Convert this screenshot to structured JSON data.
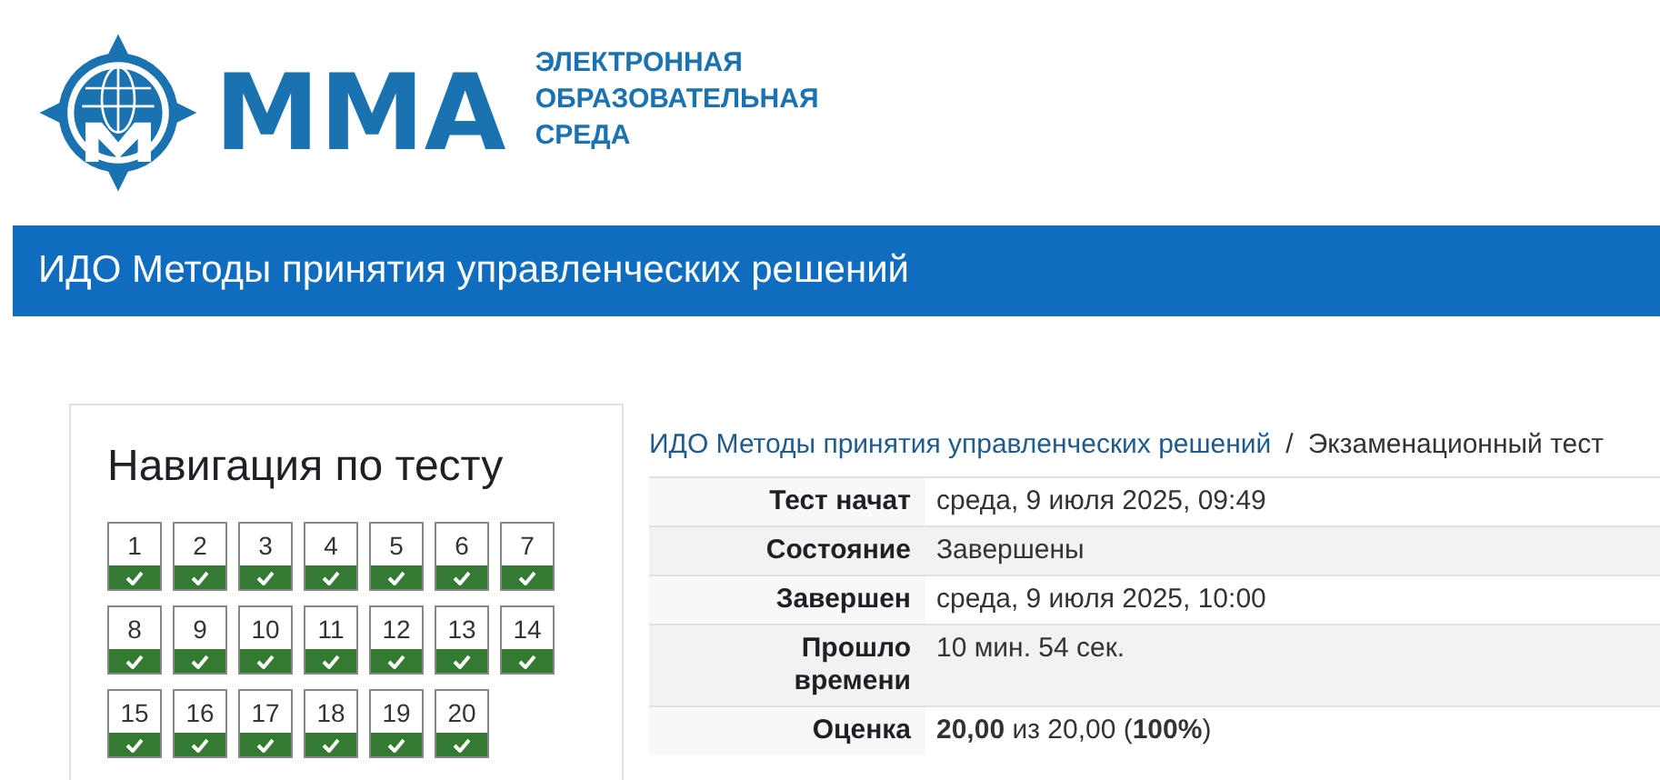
{
  "logo": {
    "mark": "ММА",
    "tagline": [
      "ЭЛЕКТРОННАЯ",
      "ОБРАЗОВАТЕЛЬНАЯ",
      "СРЕДА"
    ]
  },
  "header": {
    "title": "ИДО Методы принятия управленческих решений"
  },
  "navigation": {
    "title": "Навигация по тесту",
    "questions": [
      {
        "label": "1",
        "answered": true
      },
      {
        "label": "2",
        "answered": true
      },
      {
        "label": "3",
        "answered": true
      },
      {
        "label": "4",
        "answered": true
      },
      {
        "label": "5",
        "answered": true
      },
      {
        "label": "6",
        "answered": true
      },
      {
        "label": "7",
        "answered": true
      },
      {
        "label": "8",
        "answered": true
      },
      {
        "label": "9",
        "answered": true
      },
      {
        "label": "10",
        "answered": true
      },
      {
        "label": "11",
        "answered": true
      },
      {
        "label": "12",
        "answered": true
      },
      {
        "label": "13",
        "answered": true
      },
      {
        "label": "14",
        "answered": true
      },
      {
        "label": "15",
        "answered": true
      },
      {
        "label": "16",
        "answered": true
      },
      {
        "label": "17",
        "answered": true
      },
      {
        "label": "18",
        "answered": true
      },
      {
        "label": "19",
        "answered": true
      },
      {
        "label": "20",
        "answered": true
      }
    ]
  },
  "breadcrumb": {
    "items": [
      "ИДО Методы принятия управленческих решений",
      "Экзаменационный тест"
    ],
    "separator": "/"
  },
  "summary": {
    "rows": [
      {
        "label": "Тест начат",
        "value": "среда, 9 июля 2025, 09:49"
      },
      {
        "label": "Состояние",
        "value": "Завершены"
      },
      {
        "label": "Завершен",
        "value": "среда, 9 июля 2025, 10:00"
      },
      {
        "label": "Прошло времени",
        "value": "10 мин. 54 сек."
      },
      {
        "label": "Оценка",
        "value": "**20,00** из 20,00 (**100%**)"
      }
    ]
  }
}
